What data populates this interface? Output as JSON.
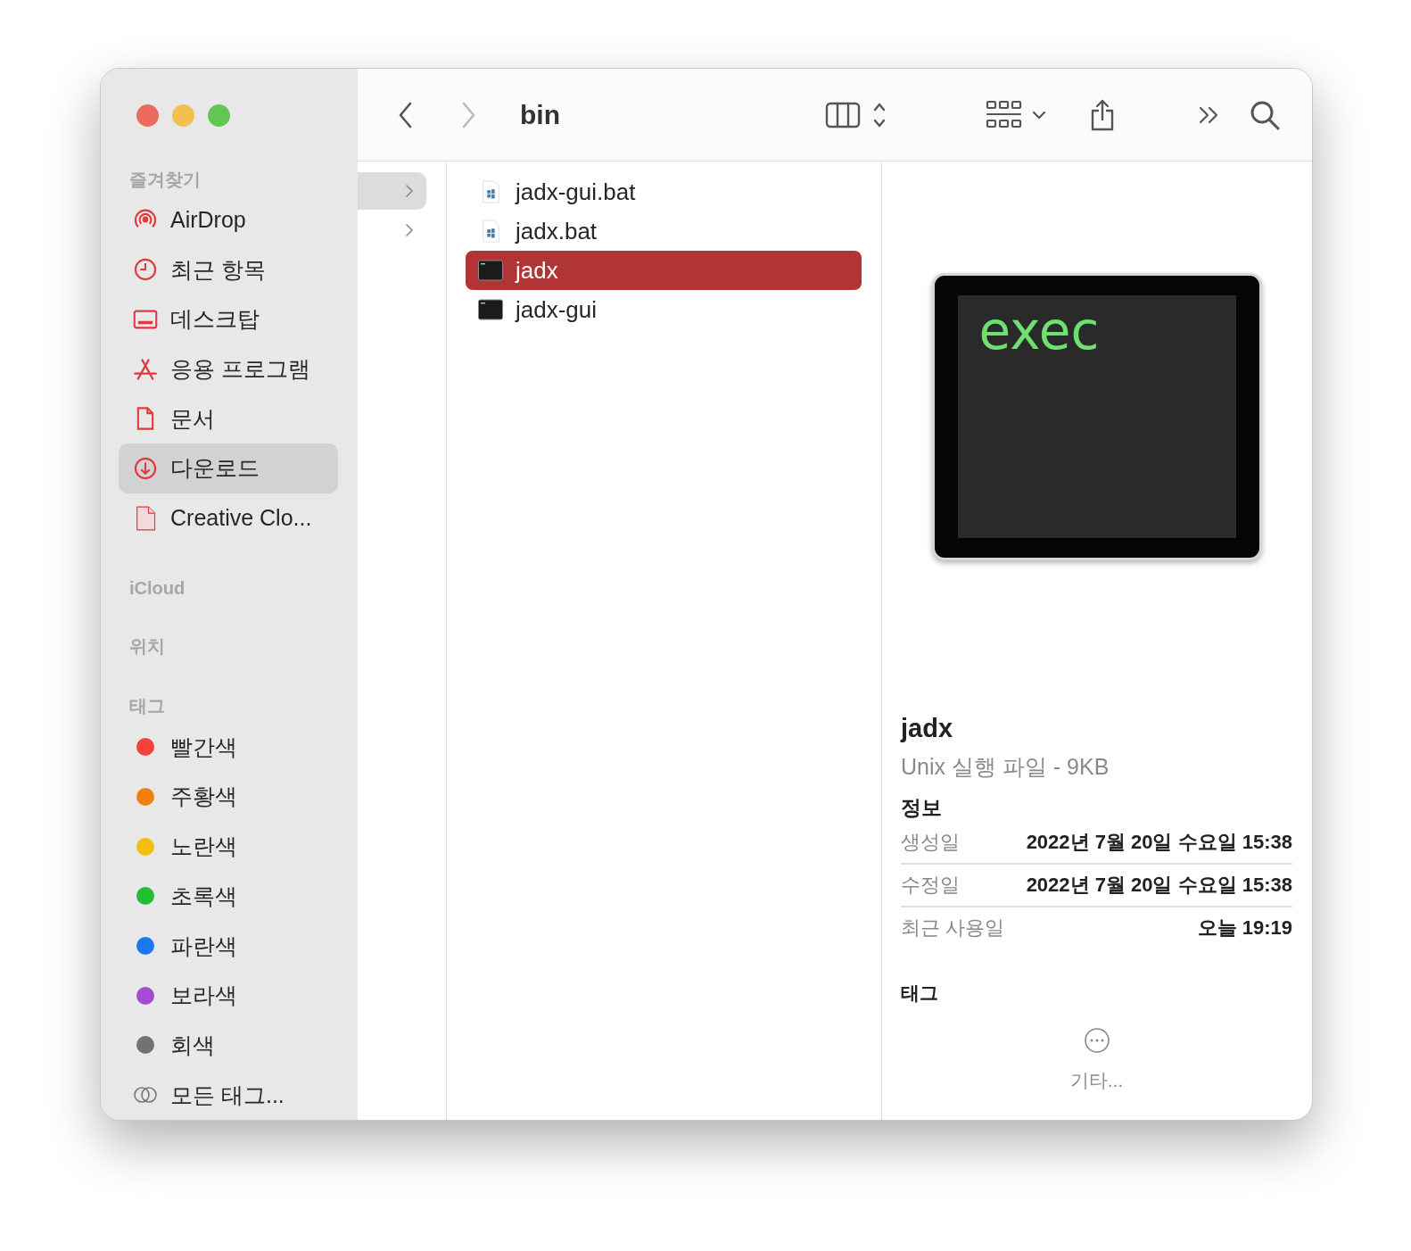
{
  "window": {
    "title": "bin"
  },
  "sidebar": {
    "favorites_heading": "즐겨찾기",
    "favorites": [
      {
        "label": "AirDrop",
        "kind": "airdrop",
        "selected": false
      },
      {
        "label": "최근 항목",
        "kind": "recents",
        "selected": false
      },
      {
        "label": "데스크탑",
        "kind": "desktop",
        "selected": false
      },
      {
        "label": "응용 프로그램",
        "kind": "applications",
        "selected": false
      },
      {
        "label": "문서",
        "kind": "documents",
        "selected": false
      },
      {
        "label": "다운로드",
        "kind": "downloads",
        "selected": true
      },
      {
        "label": "Creative Clo...",
        "kind": "cloud",
        "selected": false
      }
    ],
    "icloud_heading": "iCloud",
    "locations_heading": "위치",
    "tags_heading": "태그",
    "tags": [
      {
        "label": "빨간색",
        "color": "#f2423a",
        "kind": "dot"
      },
      {
        "label": "주황색",
        "color": "#f0800e",
        "kind": "dot"
      },
      {
        "label": "노란색",
        "color": "#f2c00c",
        "kind": "dot"
      },
      {
        "label": "초록색",
        "color": "#21bd36",
        "kind": "dot"
      },
      {
        "label": "파란색",
        "color": "#1a78f5",
        "kind": "dot"
      },
      {
        "label": "보라색",
        "color": "#a64ad3",
        "kind": "dot"
      },
      {
        "label": "회색",
        "color": "#727275",
        "kind": "dot"
      },
      {
        "label": "모든 태그...",
        "kind": "all"
      }
    ]
  },
  "parent_column": [
    {
      "selected": true
    },
    {
      "selected": false
    }
  ],
  "files": [
    {
      "name": "jadx-gui.bat",
      "kind": "bat",
      "selected": false
    },
    {
      "name": "jadx.bat",
      "kind": "bat",
      "selected": false
    },
    {
      "name": "jadx",
      "kind": "exec",
      "selected": true
    },
    {
      "name": "jadx-gui",
      "kind": "exec",
      "selected": false
    }
  ],
  "preview": {
    "icon_text": "exec",
    "name": "jadx",
    "type": "Unix 실행 파일 - 9KB",
    "info_heading": "정보",
    "info": [
      {
        "label": "생성일",
        "value": "2022년 7월 20일 수요일 15:38"
      },
      {
        "label": "수정일",
        "value": "2022년 7월 20일 수요일 15:38"
      },
      {
        "label": "최근 사용일",
        "value": "오늘 19:19"
      }
    ],
    "tags_heading": "태그",
    "more_label": "기타..."
  }
}
